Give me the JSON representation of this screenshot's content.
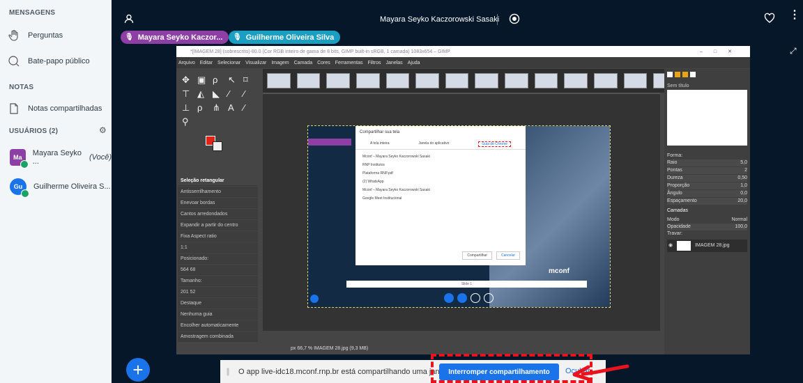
{
  "sidebar": {
    "messages_title": "MENSAGENS",
    "questions_label": "Perguntas",
    "public_chat_label": "Bate-papo público",
    "notes_title": "NOTAS",
    "shared_notes_label": "Notas compartilhadas",
    "users_title": "USUÁRIOS (2)",
    "users": [
      {
        "initials": "Ma",
        "name": "Mayara Seyko ...",
        "suffix": "(Você)",
        "color": "#8e3fa6"
      },
      {
        "initials": "Gu",
        "name": "Guilherme Oliveira S...",
        "suffix": "",
        "color": "#1a73e8"
      }
    ]
  },
  "topbar": {
    "title": "Mayara Seyko Kaczorowski Sasaki"
  },
  "talkers": [
    {
      "name": "Mayara Seyko Kaczor...",
      "color": "#8e3fa6"
    },
    {
      "name": "Guilherme Oliveira Silva",
      "color": "#1a9ec2"
    }
  ],
  "gimp": {
    "title": "*[IMAGEM 28] (sobrescrito)-80.0 (Cor RGB inteiro de gama de 8 bits, GIMP built-in sRGB, 1 camada) 1083x654 – GIMP",
    "menu": [
      "Arquivo",
      "Editar",
      "Selecionar",
      "Visualizar",
      "Imagem",
      "Camada",
      "Cores",
      "Ferramentas",
      "Filtros",
      "Janelas",
      "Ajuda"
    ],
    "tool_options_title": "Seleção retangular",
    "options": [
      "Antisserrilhamento",
      "Enevoar bordas",
      "Cantos arredondados",
      "Expandir a partir do centro",
      "Fixa        Aspect ratio",
      "1:1",
      "Posicionado:",
      "564     68",
      "Tamanho:",
      "201     52",
      "Destaque",
      "Nenhuma guia",
      "Encolher automaticamente",
      "Amostragem combinada"
    ],
    "status": "px  66,7 %  IMAGEM 28.jpg (9,3 MB)",
    "dock_labels": [
      "Sem título",
      "Forma:",
      "Raio",
      "Pontas",
      "Dureza",
      "Proporção",
      "Ângulo",
      "Espaçamento",
      "Camadas",
      "Modo",
      "Opacidade",
      "Travar:",
      "IMAGEM 28.jpg"
    ],
    "dock_values": [
      "5,0",
      "2",
      "0,50",
      "1,0",
      "0,0",
      "20,0",
      "Normal",
      "100,0"
    ],
    "dialog_title": "Compartilhar sua tela",
    "dialog_tabs": [
      "A tela inteira",
      "Janela do aplicativo",
      "Guia do Chrome"
    ],
    "dialog_items": [
      "Mconf – Mayara Seyko Kaczorowski Sasaki",
      "RNP Institutos",
      "Plataforma RNP.pdf",
      "(2) WhatsApp",
      "Mconf – Mayara Seyko Kaczorowski Sasaki",
      "Google Meet Institucional"
    ],
    "dialog_share": "Compartilhar",
    "dialog_cancel": "Cancelar",
    "slide_label": "Slide 1",
    "mconf_logo": "mconf"
  },
  "sharebar": {
    "message": "O app live-idc18.mconf.rnp.br está compartilhando uma janela",
    "stop_button": "Interromper compartilhamento",
    "hide_button": "Ocultar"
  }
}
